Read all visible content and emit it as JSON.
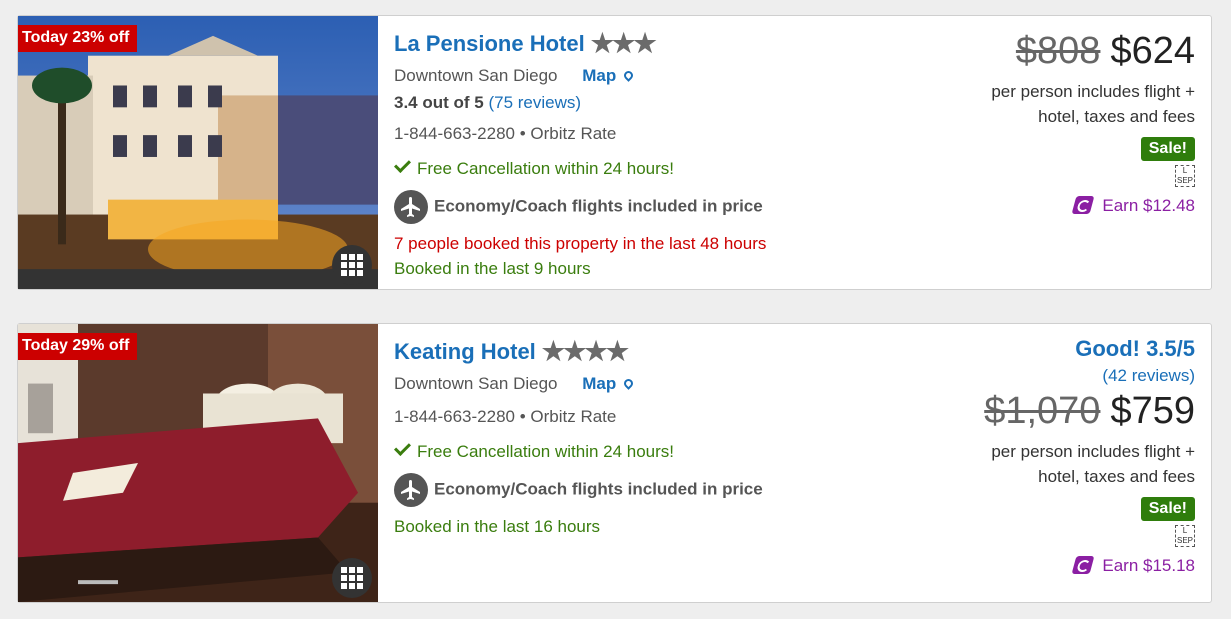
{
  "hotels": [
    {
      "deal_badge": "Today 23% off",
      "name": "La Pensione Hotel",
      "stars": "★★★",
      "area": "Downtown San Diego",
      "map_label": "Map",
      "rating_text": "3.4 out of 5",
      "reviews_text": "(75 reviews)",
      "phone": "1-844-663-2280",
      "rate_type": "• Orbitz Rate",
      "cancellation": "Free Cancellation within 24 hours!",
      "flights": "Economy/Coach flights included in price",
      "booked_people": "7 people booked this property in the last 48 hours",
      "booked_recent": "Booked in the last 9 hours",
      "old_price": "$808",
      "price": "$624",
      "price_note_1": "per person includes flight +",
      "price_note_2": "hotel, taxes and fees",
      "sale_badge": "Sale!",
      "lsep": "L SEP",
      "earn": "Earn $12.48"
    },
    {
      "deal_badge": "Today 29% off",
      "name": "Keating Hotel",
      "stars": "★★★★",
      "area": "Downtown San Diego",
      "map_label": "Map",
      "guest_rating": "Good! 3.5/5",
      "reviews_text": "(42 reviews)",
      "phone": "1-844-663-2280",
      "rate_type": "• Orbitz Rate",
      "cancellation": "Free Cancellation within 24 hours!",
      "flights": "Economy/Coach flights included in price",
      "booked_recent": "Booked in the last 16 hours",
      "old_price": "$1,070",
      "price": "$759",
      "price_note_1": "per person includes flight +",
      "price_note_2": "hotel, taxes and fees",
      "sale_badge": "Sale!",
      "lsep": "L SEP",
      "earn": "Earn $15.18"
    }
  ],
  "icons": [
    "check-icon",
    "plane-icon",
    "map-pin-icon",
    "gallery-icon",
    "earn-points-icon"
  ],
  "colors": {
    "link": "#1a6fb8",
    "deal_red": "#cc0000",
    "sale_green": "#2f7d0c",
    "earn_purple": "#8b1fa3"
  }
}
